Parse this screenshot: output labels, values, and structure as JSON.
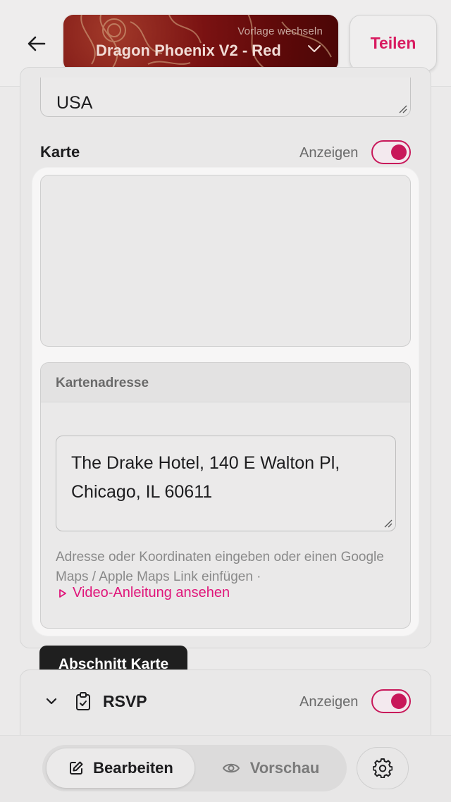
{
  "header": {
    "back_icon": "arrow-left-icon",
    "template_hint": "Vorlage wechseln",
    "template_name": "Dragon Phoenix V2 - Red",
    "share_label": "Teilen",
    "accent_color": "#d81b60"
  },
  "address": {
    "country_value": "USA"
  },
  "map_section": {
    "label": "Karte",
    "toggle_label": "Anzeigen",
    "toggle_on": true,
    "address_heading": "Kartenadresse",
    "address_line1": "The Drake Hotel, 140 E Walton Pl,",
    "address_line2": "Chicago, IL 60611",
    "help_text": "Adresse oder Koordinaten eingeben oder einen Google Maps / Apple Maps Link einfügen ·",
    "video_link": "Video-Anleitung ansehen"
  },
  "tooltip": {
    "text": "Abschnitt Karte"
  },
  "rsvp_section": {
    "label": "RSVP",
    "toggle_label": "Anzeigen",
    "toggle_on": true
  },
  "bottom_bar": {
    "edit_label": "Bearbeiten",
    "preview_label": "Vorschau",
    "settings_icon": "gear-icon"
  }
}
